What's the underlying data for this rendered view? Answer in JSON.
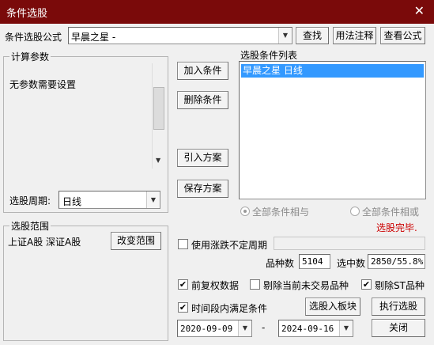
{
  "window": {
    "title": "条件选股",
    "close_glyph": "✕"
  },
  "formula": {
    "label": "条件选股公式",
    "value": "早晨之星  -",
    "find_button": "查找",
    "usage_button": "用法注释",
    "view_button": "查看公式"
  },
  "params": {
    "group_label": "计算参数",
    "message": "无参数需要设置",
    "period_label": "选股周期:",
    "period_value": "日线"
  },
  "actions": {
    "add_condition": "加入条件",
    "delete_condition": "删除条件",
    "import_plan": "引入方案",
    "save_plan": "保存方案"
  },
  "condition_list": {
    "label": "选股条件列表",
    "items": [
      "早晨之星  日线"
    ]
  },
  "logic": {
    "all_and": "全部条件相与",
    "all_or": "全部条件相或",
    "selected": "all_and"
  },
  "status": {
    "text": "选股完毕.",
    "color": "#cc0000"
  },
  "range": {
    "group_label": "选股范围",
    "value": "上证A股 深证A股",
    "change_button": "改变范围"
  },
  "options": {
    "uncertain_period": {
      "label": "使用涨跌不定周期",
      "checked": false
    },
    "adjust_forward": {
      "label": "前复权数据",
      "checked": true
    },
    "exclude_untraded": {
      "label": "剔除当前未交易品种",
      "checked": false
    },
    "exclude_st": {
      "label": "剔除ST品种",
      "checked": true
    },
    "time_range": {
      "label": "时间段内满足条件",
      "checked": true
    }
  },
  "stats": {
    "count_label": "品种数",
    "count_value": "5104",
    "selected_label": "选中数",
    "selected_value": "2850/55.8%"
  },
  "dates": {
    "start": "2020-09-09",
    "separator": "-",
    "end": "2024-09-16"
  },
  "bottom_buttons": {
    "to_block": "选股入板块",
    "execute": "执行选股",
    "close": "关闭"
  },
  "colors": {
    "titlebar": "#7a0a0a",
    "selection": "#3399ff",
    "status": "#cc0000"
  }
}
